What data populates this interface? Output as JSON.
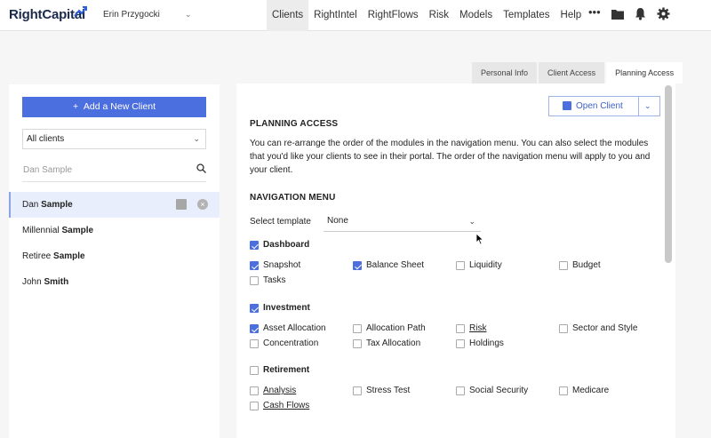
{
  "header": {
    "logo_text": "RightCapital",
    "user_name": "Erin Przygocki",
    "nav": [
      "Clients",
      "RightIntel",
      "RightFlows",
      "Risk",
      "Models",
      "Templates",
      "Help"
    ],
    "active_nav": "Clients"
  },
  "tabs": {
    "items": [
      "Personal Info",
      "Client Access",
      "Planning Access"
    ],
    "active": "Planning Access"
  },
  "sidebar": {
    "add_client_label": "Add a New Client",
    "filter_value": "All clients",
    "search_placeholder": "Dan Sample",
    "clients": [
      {
        "first": "Dan",
        "last": "Sample",
        "selected": true
      },
      {
        "first": "Millennial",
        "last": "Sample",
        "selected": false
      },
      {
        "first": "Retiree",
        "last": "Sample",
        "selected": false
      },
      {
        "first": "John",
        "last": "Smith",
        "selected": false
      }
    ]
  },
  "main": {
    "open_client_label": "Open Client",
    "section_title": "PLANNING ACCESS",
    "description": "You can re-arrange the order of the modules in the navigation menu. You can also select the modules that you'd like your clients to see in their portal. The order of the navigation menu will apply to you and your client.",
    "nav_menu_title": "NAVIGATION MENU",
    "select_template_label": "Select template",
    "template_value": "None",
    "groups": [
      {
        "name": "Dashboard",
        "checked": true,
        "items": [
          {
            "label": "Snapshot",
            "checked": true
          },
          {
            "label": "Balance Sheet",
            "checked": true
          },
          {
            "label": "Liquidity",
            "checked": false
          },
          {
            "label": "Budget",
            "checked": false
          },
          {
            "label": "Tasks",
            "checked": false
          }
        ]
      },
      {
        "name": "Investment",
        "checked": true,
        "items": [
          {
            "label": "Asset Allocation",
            "checked": true
          },
          {
            "label": "Allocation Path",
            "checked": false
          },
          {
            "label": "Risk",
            "checked": false,
            "link": true
          },
          {
            "label": "Sector and Style",
            "checked": false
          },
          {
            "label": "Concentration",
            "checked": false
          },
          {
            "label": "Tax Allocation",
            "checked": false
          },
          {
            "label": "Holdings",
            "checked": false
          }
        ]
      },
      {
        "name": "Retirement",
        "checked": false,
        "items": [
          {
            "label": "Analysis",
            "checked": false,
            "link": true
          },
          {
            "label": "Stress Test",
            "checked": false
          },
          {
            "label": "Social Security",
            "checked": false
          },
          {
            "label": "Medicare",
            "checked": false
          },
          {
            "label": "Cash Flows",
            "checked": false,
            "link": true
          }
        ]
      }
    ]
  }
}
